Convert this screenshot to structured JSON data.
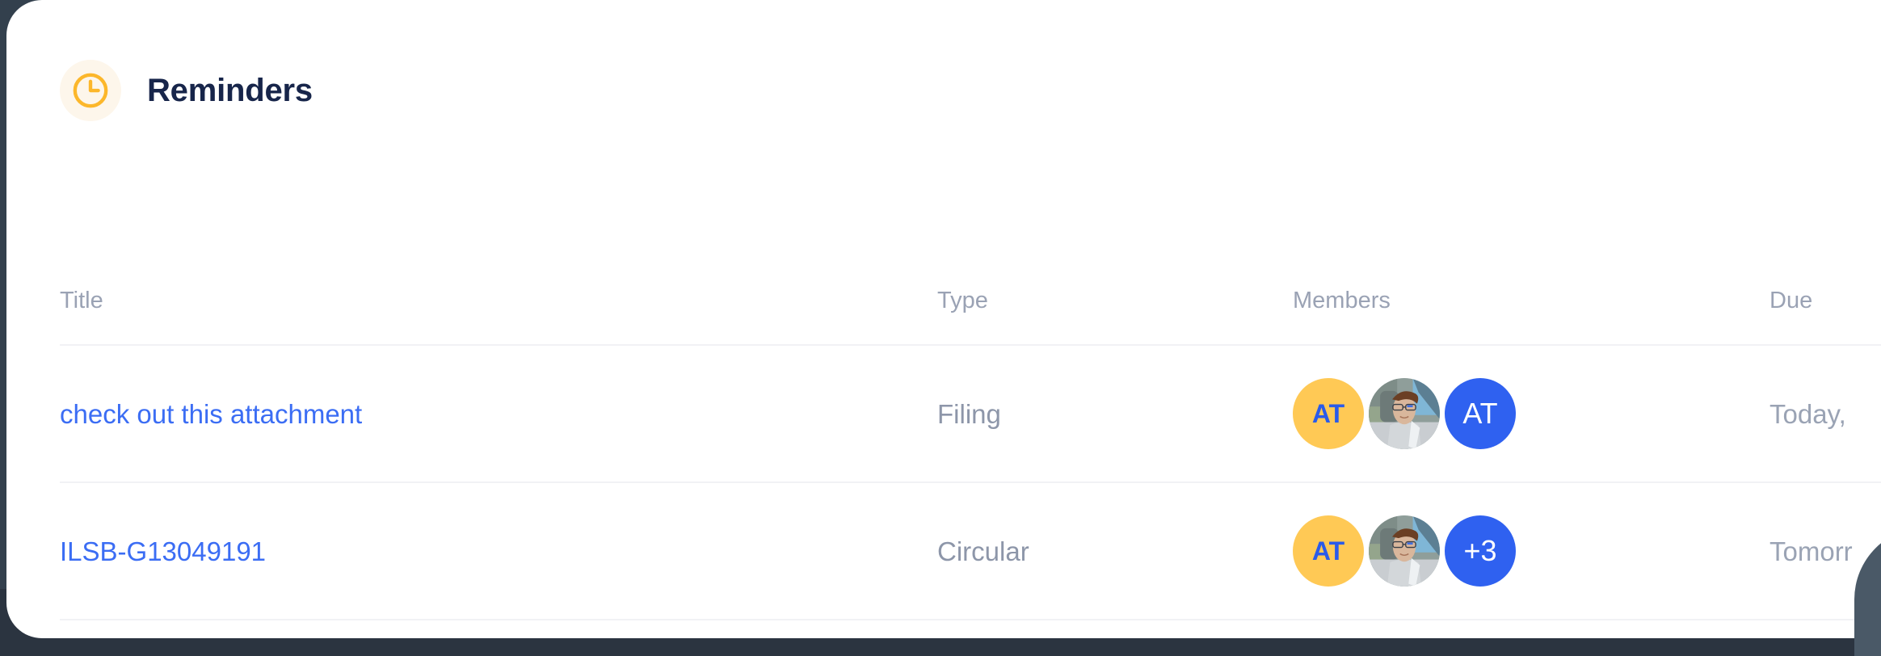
{
  "panel": {
    "title": "Reminders",
    "icon": "clock-icon",
    "icon_color": "#fcb72b",
    "icon_bg": "#fdf6eb",
    "title_color": "#17254a"
  },
  "table": {
    "columns": [
      {
        "key": "title",
        "label": "Title"
      },
      {
        "key": "type",
        "label": "Type"
      },
      {
        "key": "members",
        "label": "Members"
      },
      {
        "key": "due",
        "label": "Due"
      }
    ],
    "rows": [
      {
        "title": "check out this attachment",
        "type": "Filing",
        "due": "Today,",
        "members": [
          {
            "kind": "initials",
            "label": "AT",
            "bg": "#ffc955",
            "fg": "#2a5bea"
          },
          {
            "kind": "photo",
            "label": "",
            "bg": "#9fb0ae",
            "fg": "#ffffff"
          },
          {
            "kind": "initials",
            "label": "AT",
            "bg": "#2f61f0",
            "fg": "#ffffff"
          }
        ]
      },
      {
        "title": "ILSB-G13049191",
        "type": "Circular",
        "due": "Tomorr",
        "members": [
          {
            "kind": "initials",
            "label": "AT",
            "bg": "#ffc955",
            "fg": "#2a5bea"
          },
          {
            "kind": "photo",
            "label": "",
            "bg": "#9fb0ae",
            "fg": "#ffffff"
          },
          {
            "kind": "overflow",
            "label": "+3",
            "bg": "#2f61f0",
            "fg": "#ffffff"
          }
        ]
      }
    ]
  },
  "colors": {
    "link": "#3b6df4",
    "muted": "#8d96a9",
    "header_muted": "#9aa2b4",
    "divider": "#f1f2f5",
    "card_bg": "#ffffff",
    "backdrop": "#33404d",
    "corner_shape": "#4a5967"
  }
}
